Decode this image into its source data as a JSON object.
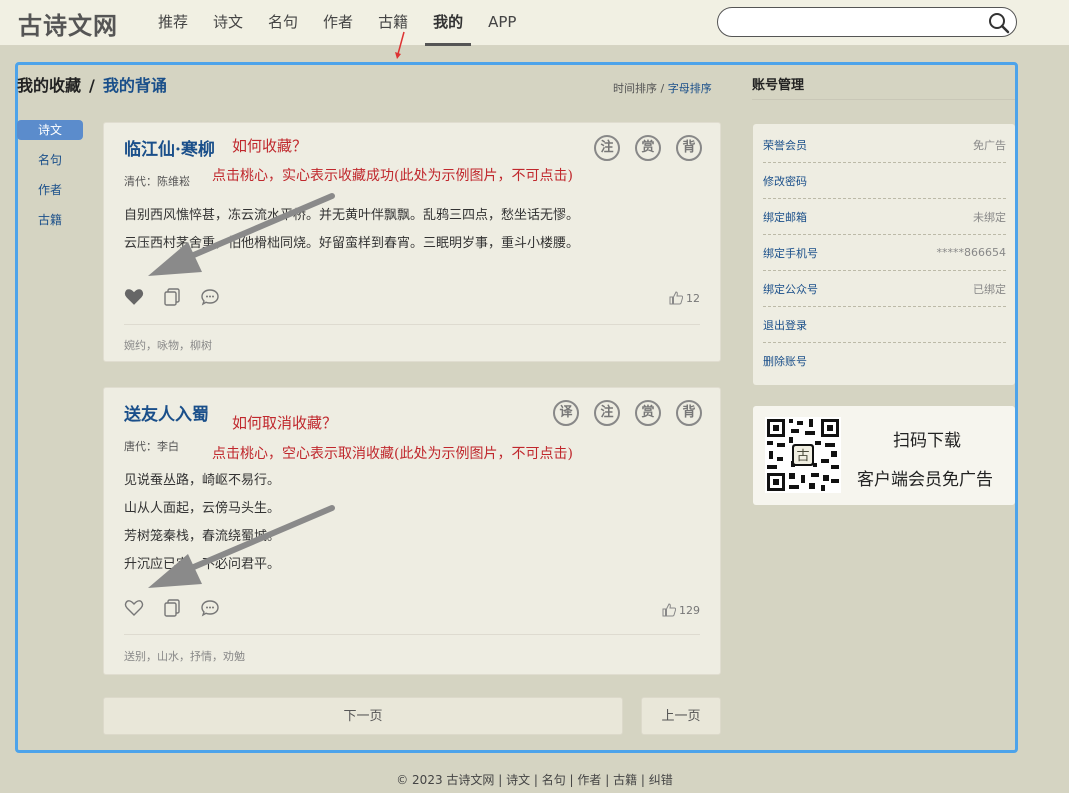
{
  "header": {
    "logo": "古诗文网",
    "nav": [
      "推荐",
      "诗文",
      "名句",
      "作者",
      "古籍",
      "我的",
      "APP"
    ],
    "active_nav": "我的",
    "search_placeholder": ""
  },
  "breadcrumb": {
    "current": "我的收藏",
    "separator": "/",
    "link": "我的背诵"
  },
  "sort": {
    "time": "时间排序",
    "separator": "/",
    "alpha": "字母排序"
  },
  "leftnav": [
    "诗文",
    "名句",
    "作者",
    "古籍"
  ],
  "poems": [
    {
      "title": "临江仙·寒柳",
      "author": "清代：陈维崧",
      "annotation_title": "如何收藏？",
      "annotation_desc": "点击桃心，实心表示收藏成功(此处为示例图片，不可点击)",
      "badges": [
        "注",
        "赏",
        "背"
      ],
      "lines": [
        "自别西风憔悴甚，冻云流水平桥。并无黄叶伴飘飘。乱鸦三四点，愁坐话无憀。",
        "云压西村茅舍重，怕他榾柮同烧。好留蛮样到春宵。三眠明岁事，重斗小楼腰。"
      ],
      "favorited": true,
      "likes": "12",
      "tags": "婉约，咏物，柳树"
    },
    {
      "title": "送友人入蜀",
      "author": "唐代：李白",
      "annotation_title": "如何取消收藏？",
      "annotation_desc": "点击桃心，空心表示取消收藏(此处为示例图片，不可点击)",
      "badges": [
        "译",
        "注",
        "赏",
        "背"
      ],
      "lines": [
        "见说蚕丛路，崎岖不易行。",
        "山从人面起，云傍马头生。",
        "芳树笼秦栈，春流绕蜀城。",
        "升沉应已定，不必问君平。"
      ],
      "favorited": false,
      "likes": "129",
      "tags": "送别，山水，抒情，劝勉"
    }
  ],
  "pagination": {
    "next": "下一页",
    "prev": "上一页"
  },
  "account": {
    "title": "账号管理",
    "rows": [
      {
        "label": "荣誉会员",
        "value": "免广告"
      },
      {
        "label": "修改密码",
        "value": ""
      },
      {
        "label": "绑定邮箱",
        "value": "未绑定"
      },
      {
        "label": "绑定手机号",
        "value": "*****866654"
      },
      {
        "label": "绑定公众号",
        "value": "已绑定"
      },
      {
        "label": "退出登录",
        "value": ""
      },
      {
        "label": "删除账号",
        "value": ""
      }
    ]
  },
  "qr": {
    "line1": "扫码下载",
    "line2": "客户端会员免广告",
    "center_char": "古"
  },
  "footer": "© 2023 古诗文网 | 诗文 | 名句 | 作者 | 古籍 | 纠错"
}
